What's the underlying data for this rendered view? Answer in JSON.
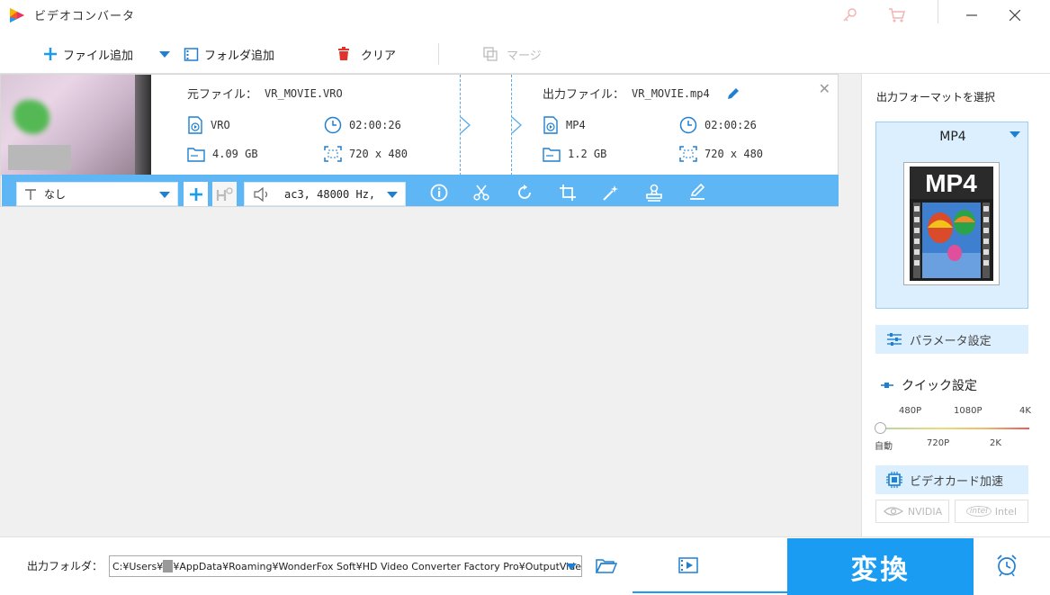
{
  "window": {
    "title": "ビデオコンバータ"
  },
  "toolbar": {
    "add_file": "ファイル追加",
    "add_folder": "フォルダ追加",
    "clear": "クリア",
    "merge": "マージ"
  },
  "file": {
    "source_label": "元ファイル：",
    "source_name": "VR_MOVIE.VRO",
    "output_label": "出力ファイル：",
    "output_name": "VR_MOVIE.mp4",
    "source": {
      "format": "VRO",
      "duration": "02:00:26",
      "size": "4.09 GB",
      "resolution": "720 x 480"
    },
    "output": {
      "format": "MP4",
      "duration": "02:00:26",
      "size": "1.2 GB",
      "resolution": "720 x 480"
    },
    "subtitle_select": "なし",
    "audio_select": "ac3, 48000 Hz,"
  },
  "panel": {
    "title": "出力フォーマットを選択",
    "format": "MP4",
    "format_image_text": "MP4",
    "param_button": "パラメータ設定",
    "quick_title": "クイック設定",
    "quality_top": [
      "480P",
      "1080P",
      "4K"
    ],
    "quality_bottom": [
      "自動",
      "720P",
      "2K"
    ],
    "gpu_button": "ビデオカード加速",
    "gpu_nvidia": "NVIDIA",
    "gpu_intel": "Intel"
  },
  "bottom": {
    "output_label": "出力フォルダ：",
    "path_start": "C:¥Users¥",
    "path_end": "¥AppData¥Roaming¥WonderFox Soft¥HD Video Converter Factory Pro¥OutputVide",
    "convert": "変換"
  },
  "colors": {
    "accent": "#1a9cf3",
    "strip": "#5eb6f5",
    "delete": "#e0332b"
  }
}
